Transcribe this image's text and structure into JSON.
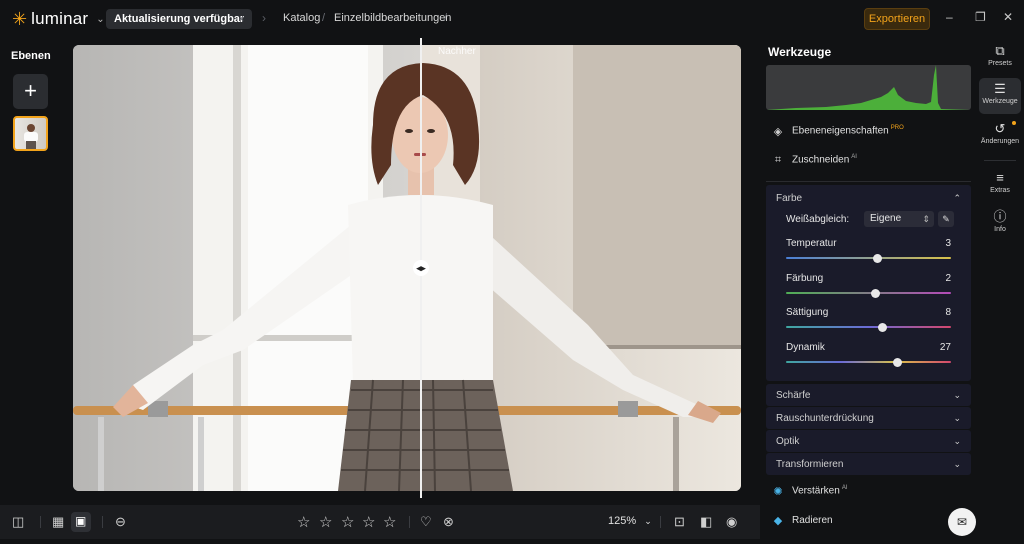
{
  "app": {
    "logo_text": "luminar",
    "update_label": "Aktualisierung verfügbar",
    "export_label": "Exportieren"
  },
  "breadcrumb": {
    "items": [
      "Katalog",
      "Einzelbildbearbeitungen"
    ],
    "separator": "/"
  },
  "layers": {
    "title": "Ebenen",
    "add_label": "+"
  },
  "canvas": {
    "after_label": "Nachher",
    "split_handle": "◂▸"
  },
  "bottom_toolbar": {
    "zoom": "125%",
    "rating_stars": 5
  },
  "tools": {
    "title": "Werkzeuge",
    "layer_properties": {
      "label": "Ebeneneigenschaften",
      "badge": "PRO"
    },
    "crop": {
      "label": "Zuschneiden",
      "badge": "AI"
    },
    "farbe": {
      "title": "Farbe",
      "white_balance_label": "Weißabgleich:",
      "white_balance_value": "Eigene",
      "sliders": [
        {
          "label": "Temperatur",
          "value": "3",
          "pos": 0.55
        },
        {
          "label": "Färbung",
          "value": "2",
          "pos": 0.54
        },
        {
          "label": "Sättigung",
          "value": "8",
          "pos": 0.58
        },
        {
          "label": "Dynamik",
          "value": "27",
          "pos": 0.67
        }
      ]
    },
    "sections": [
      "Schärfe",
      "Rauschunterdrückung",
      "Optik",
      "Transformieren"
    ],
    "enhance": {
      "label": "Verstärken",
      "badge": "AI"
    },
    "erase": {
      "label": "Radieren"
    }
  },
  "rail": {
    "presets": "Presets",
    "tools": "Werkzeuge",
    "changes": "Änderungen",
    "extras": "Extras",
    "info": "Info"
  },
  "colors": {
    "accent": "#f2a31b",
    "histogram_green": "#4caf3a"
  }
}
